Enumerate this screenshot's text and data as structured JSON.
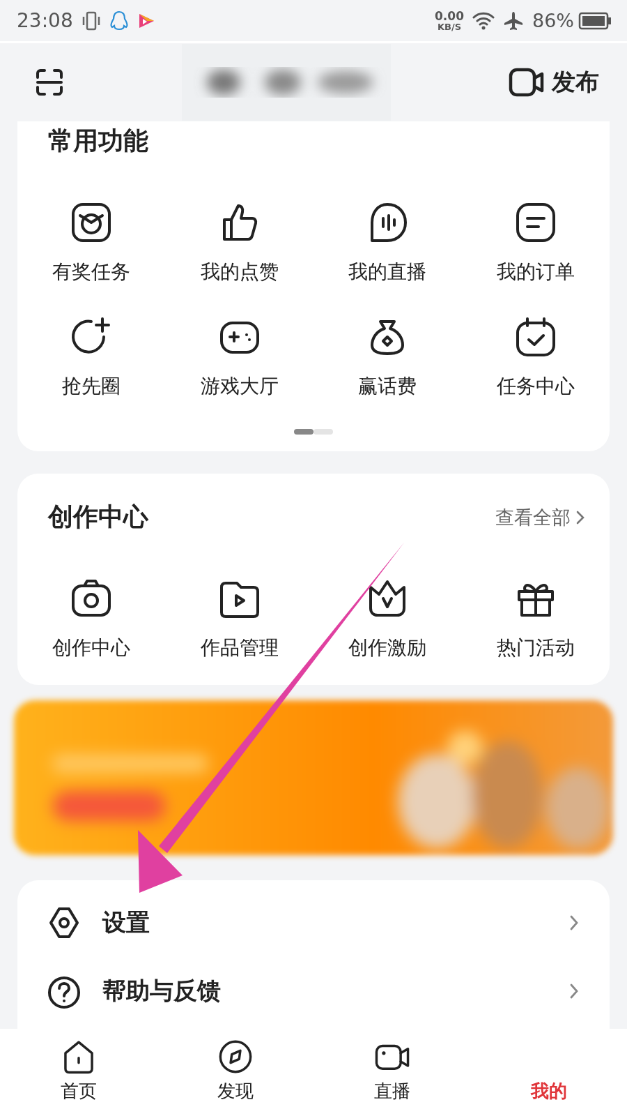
{
  "status_bar": {
    "time": "23:08",
    "net_speed": "0.00",
    "net_unit": "KB/S",
    "battery": "86%"
  },
  "header": {
    "publish_label": "发布"
  },
  "common_functions": {
    "title": "常用功能",
    "items": [
      {
        "label": "有奖任务"
      },
      {
        "label": "我的点赞"
      },
      {
        "label": "我的直播"
      },
      {
        "label": "我的订单"
      },
      {
        "label": "抢先圈"
      },
      {
        "label": "游戏大厅"
      },
      {
        "label": "赢话费"
      },
      {
        "label": "任务中心"
      }
    ],
    "pages": [
      {
        "selected": true
      },
      {
        "selected": false
      }
    ]
  },
  "creation_center": {
    "title": "创作中心",
    "view_all": "查看全部",
    "items": [
      {
        "label": "创作中心"
      },
      {
        "label": "作品管理"
      },
      {
        "label": "创作激励"
      },
      {
        "label": "热门活动"
      }
    ]
  },
  "menu": [
    {
      "label": "设置"
    },
    {
      "label": "帮助与反馈"
    }
  ],
  "bottom_nav": [
    {
      "label": "首页",
      "selected": false
    },
    {
      "label": "发现",
      "selected": false
    },
    {
      "label": "直播",
      "selected": false
    },
    {
      "label": "我的",
      "selected": true
    }
  ]
}
